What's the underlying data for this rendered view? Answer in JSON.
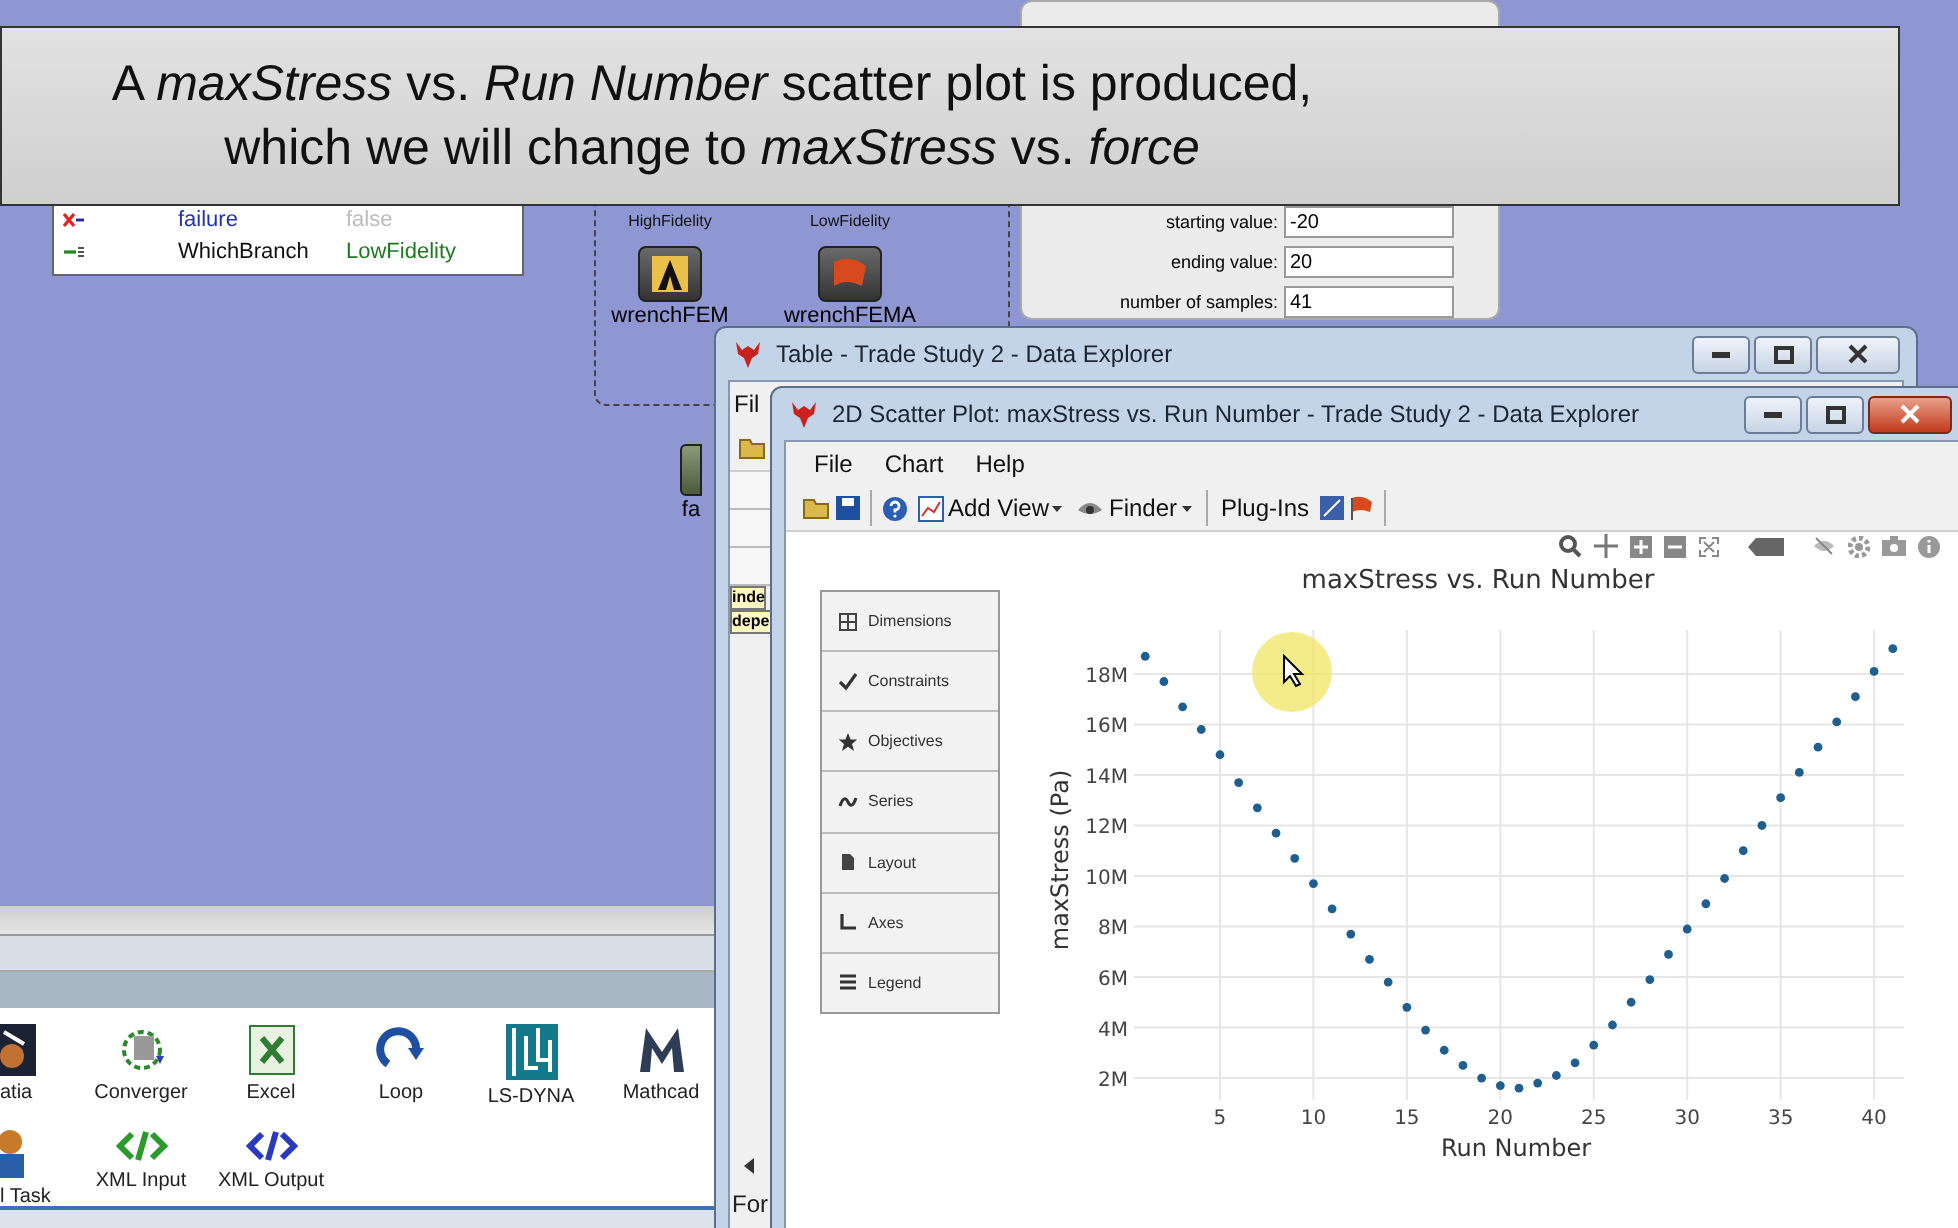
{
  "caption_lines": [
    "A *maxStress* vs. *Run Number* scatter plot is produced,",
    "which we will change to *maxStress* vs. *force*"
  ],
  "variables": [
    {
      "kind": "output",
      "name": "failure",
      "value": "false",
      "disabled": true
    },
    {
      "kind": "input",
      "name": "WhichBranch",
      "value": "LowFidelity",
      "disabled": false
    }
  ],
  "workflow": {
    "branches": [
      {
        "label": "HighFidelity",
        "node": "wrenchFEM",
        "kind": "fem"
      },
      {
        "label": "LowFidelity",
        "node": "wrenchFEMA",
        "kind": "fema"
      }
    ],
    "partial_node": "fa"
  },
  "sweep_form": [
    {
      "label": "starting value:",
      "value": "-20"
    },
    {
      "label": "ending value:",
      "value": "20"
    },
    {
      "label": "number of samples:",
      "value": "41"
    }
  ],
  "palette": [
    [
      {
        "label": "atia",
        "kind": "catia"
      },
      {
        "label": "Converger",
        "kind": "converger"
      },
      {
        "label": "Excel",
        "kind": "excel"
      },
      {
        "label": "Loop",
        "kind": "loop"
      },
      {
        "label": "LS-DYNA",
        "kind": "lsdyna"
      },
      {
        "label": "Mathcad",
        "kind": "mathcad"
      }
    ],
    [
      {
        "label": "l Task",
        "kind": "person"
      },
      {
        "label": "XML Input",
        "kind": "xml-in"
      },
      {
        "label": "XML Output",
        "kind": "xml-out"
      }
    ]
  ],
  "table_window": {
    "title": "Table - Trade Study 2 - Data Explorer",
    "menu": [
      "Fil"
    ],
    "row_labels": [
      "inde",
      "depe"
    ],
    "side_label": "For"
  },
  "scatter_window": {
    "title": "2D Scatter Plot: maxStress vs. Run Number - Trade Study 2 - Data Explorer",
    "menu": [
      "File",
      "Chart",
      "Help"
    ],
    "toolbar": [
      {
        "label": "Add View",
        "kind": "add-view",
        "dropdown": true
      },
      {
        "label": "Finder",
        "kind": "finder",
        "dropdown": true
      },
      {
        "label": "Plug-Ins",
        "kind": "plug-ins",
        "dropdown": false
      }
    ],
    "panel": [
      {
        "label": "Dimensions",
        "kind": "grid"
      },
      {
        "label": "Constraints",
        "kind": "check"
      },
      {
        "label": "Objectives",
        "kind": "star"
      },
      {
        "label": "Series",
        "kind": "wave"
      },
      {
        "label": "Layout",
        "kind": "page"
      },
      {
        "label": "Axes",
        "kind": "axes"
      },
      {
        "label": "Legend",
        "kind": "lines"
      }
    ],
    "chart_data": {
      "type": "scatter",
      "title": "maxStress vs. Run Number",
      "xlabel": "Run Number",
      "ylabel": "maxStress (Pa)",
      "grid": true,
      "x": [
        1,
        2,
        3,
        4,
        5,
        6,
        7,
        8,
        9,
        10,
        11,
        12,
        13,
        14,
        15,
        16,
        17,
        18,
        19,
        20,
        21,
        22,
        23,
        24,
        25,
        26,
        27,
        28,
        29,
        30,
        31,
        32,
        33,
        34,
        35,
        36,
        37,
        38,
        39,
        40,
        41
      ],
      "series": [
        {
          "color": "#1f5f8f",
          "values": [
            18700000,
            17700000,
            16700000,
            15800000,
            14800000,
            13700000,
            12700000,
            11700000,
            10700000,
            9700000,
            8700000,
            7700000,
            6700000,
            5800000,
            4800000,
            3900000,
            3100000,
            2500000,
            2000000,
            1700000,
            1600000,
            1800000,
            2100000,
            2600000,
            3300000,
            4100000,
            5000000,
            5900000,
            6900000,
            7900000,
            8900000,
            9900000,
            11000000,
            12000000,
            13100000,
            14100000,
            15100000,
            16100000,
            17100000,
            18100000,
            19000000
          ]
        }
      ],
      "xlim": [
        0.4,
        41.6
      ],
      "ylim": [
        1130000,
        19740000
      ],
      "xticks": [
        5,
        10,
        15,
        20,
        25,
        30,
        35,
        40
      ],
      "yticks": [
        {
          "value": 2000000,
          "label": "2M"
        },
        {
          "value": 4000000,
          "label": "4M"
        },
        {
          "value": 6000000,
          "label": "6M"
        },
        {
          "value": 8000000,
          "label": "8M"
        },
        {
          "value": 10000000,
          "label": "10M"
        },
        {
          "value": 12000000,
          "label": "12M"
        },
        {
          "value": 14000000,
          "label": "14M"
        },
        {
          "value": 16000000,
          "label": "16M"
        },
        {
          "value": 18000000,
          "label": "18M"
        }
      ]
    }
  }
}
